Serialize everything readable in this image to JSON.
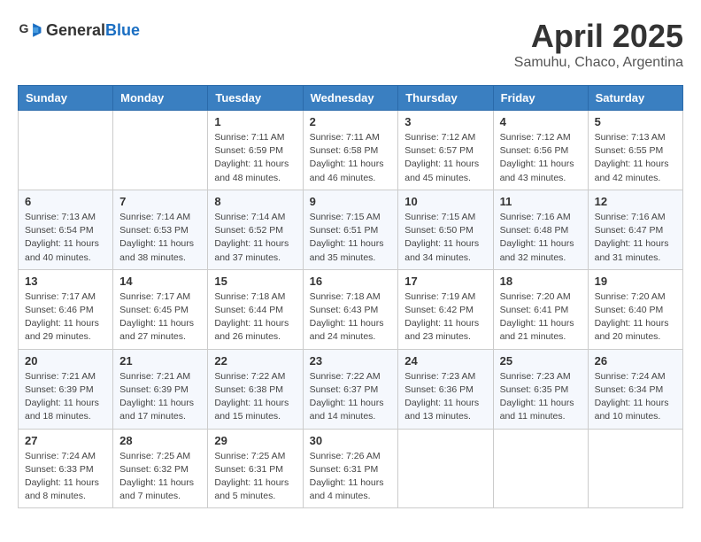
{
  "header": {
    "logo_general": "General",
    "logo_blue": "Blue",
    "month": "April 2025",
    "location": "Samuhu, Chaco, Argentina"
  },
  "columns": [
    "Sunday",
    "Monday",
    "Tuesday",
    "Wednesday",
    "Thursday",
    "Friday",
    "Saturday"
  ],
  "weeks": [
    [
      {
        "day": "",
        "info": ""
      },
      {
        "day": "",
        "info": ""
      },
      {
        "day": "1",
        "info": "Sunrise: 7:11 AM\nSunset: 6:59 PM\nDaylight: 11 hours and 48 minutes."
      },
      {
        "day": "2",
        "info": "Sunrise: 7:11 AM\nSunset: 6:58 PM\nDaylight: 11 hours and 46 minutes."
      },
      {
        "day": "3",
        "info": "Sunrise: 7:12 AM\nSunset: 6:57 PM\nDaylight: 11 hours and 45 minutes."
      },
      {
        "day": "4",
        "info": "Sunrise: 7:12 AM\nSunset: 6:56 PM\nDaylight: 11 hours and 43 minutes."
      },
      {
        "day": "5",
        "info": "Sunrise: 7:13 AM\nSunset: 6:55 PM\nDaylight: 11 hours and 42 minutes."
      }
    ],
    [
      {
        "day": "6",
        "info": "Sunrise: 7:13 AM\nSunset: 6:54 PM\nDaylight: 11 hours and 40 minutes."
      },
      {
        "day": "7",
        "info": "Sunrise: 7:14 AM\nSunset: 6:53 PM\nDaylight: 11 hours and 38 minutes."
      },
      {
        "day": "8",
        "info": "Sunrise: 7:14 AM\nSunset: 6:52 PM\nDaylight: 11 hours and 37 minutes."
      },
      {
        "day": "9",
        "info": "Sunrise: 7:15 AM\nSunset: 6:51 PM\nDaylight: 11 hours and 35 minutes."
      },
      {
        "day": "10",
        "info": "Sunrise: 7:15 AM\nSunset: 6:50 PM\nDaylight: 11 hours and 34 minutes."
      },
      {
        "day": "11",
        "info": "Sunrise: 7:16 AM\nSunset: 6:48 PM\nDaylight: 11 hours and 32 minutes."
      },
      {
        "day": "12",
        "info": "Sunrise: 7:16 AM\nSunset: 6:47 PM\nDaylight: 11 hours and 31 minutes."
      }
    ],
    [
      {
        "day": "13",
        "info": "Sunrise: 7:17 AM\nSunset: 6:46 PM\nDaylight: 11 hours and 29 minutes."
      },
      {
        "day": "14",
        "info": "Sunrise: 7:17 AM\nSunset: 6:45 PM\nDaylight: 11 hours and 27 minutes."
      },
      {
        "day": "15",
        "info": "Sunrise: 7:18 AM\nSunset: 6:44 PM\nDaylight: 11 hours and 26 minutes."
      },
      {
        "day": "16",
        "info": "Sunrise: 7:18 AM\nSunset: 6:43 PM\nDaylight: 11 hours and 24 minutes."
      },
      {
        "day": "17",
        "info": "Sunrise: 7:19 AM\nSunset: 6:42 PM\nDaylight: 11 hours and 23 minutes."
      },
      {
        "day": "18",
        "info": "Sunrise: 7:20 AM\nSunset: 6:41 PM\nDaylight: 11 hours and 21 minutes."
      },
      {
        "day": "19",
        "info": "Sunrise: 7:20 AM\nSunset: 6:40 PM\nDaylight: 11 hours and 20 minutes."
      }
    ],
    [
      {
        "day": "20",
        "info": "Sunrise: 7:21 AM\nSunset: 6:39 PM\nDaylight: 11 hours and 18 minutes."
      },
      {
        "day": "21",
        "info": "Sunrise: 7:21 AM\nSunset: 6:39 PM\nDaylight: 11 hours and 17 minutes."
      },
      {
        "day": "22",
        "info": "Sunrise: 7:22 AM\nSunset: 6:38 PM\nDaylight: 11 hours and 15 minutes."
      },
      {
        "day": "23",
        "info": "Sunrise: 7:22 AM\nSunset: 6:37 PM\nDaylight: 11 hours and 14 minutes."
      },
      {
        "day": "24",
        "info": "Sunrise: 7:23 AM\nSunset: 6:36 PM\nDaylight: 11 hours and 13 minutes."
      },
      {
        "day": "25",
        "info": "Sunrise: 7:23 AM\nSunset: 6:35 PM\nDaylight: 11 hours and 11 minutes."
      },
      {
        "day": "26",
        "info": "Sunrise: 7:24 AM\nSunset: 6:34 PM\nDaylight: 11 hours and 10 minutes."
      }
    ],
    [
      {
        "day": "27",
        "info": "Sunrise: 7:24 AM\nSunset: 6:33 PM\nDaylight: 11 hours and 8 minutes."
      },
      {
        "day": "28",
        "info": "Sunrise: 7:25 AM\nSunset: 6:32 PM\nDaylight: 11 hours and 7 minutes."
      },
      {
        "day": "29",
        "info": "Sunrise: 7:25 AM\nSunset: 6:31 PM\nDaylight: 11 hours and 5 minutes."
      },
      {
        "day": "30",
        "info": "Sunrise: 7:26 AM\nSunset: 6:31 PM\nDaylight: 11 hours and 4 minutes."
      },
      {
        "day": "",
        "info": ""
      },
      {
        "day": "",
        "info": ""
      },
      {
        "day": "",
        "info": ""
      }
    ]
  ]
}
